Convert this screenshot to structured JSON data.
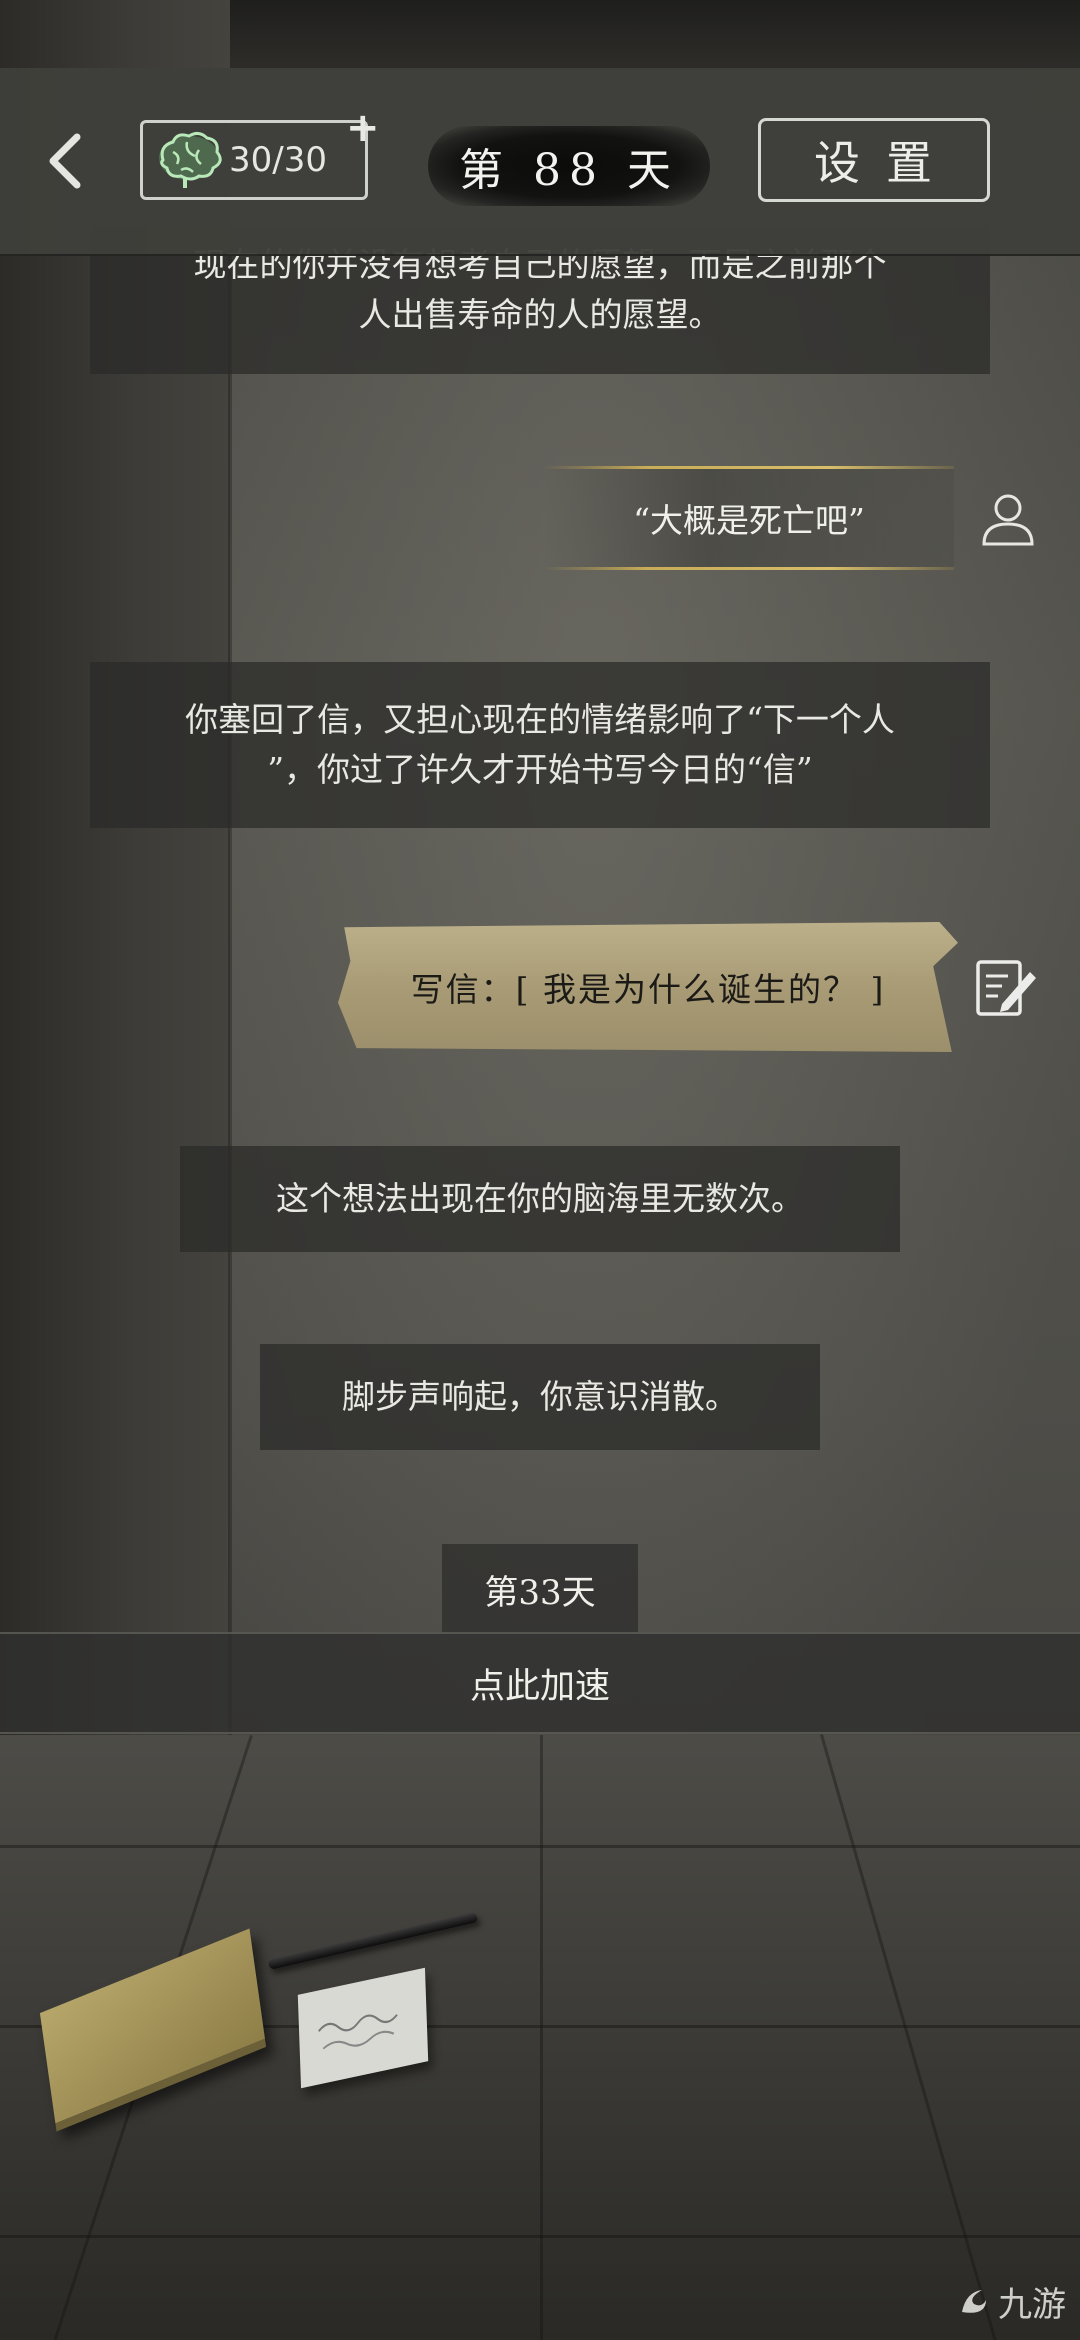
{
  "header": {
    "brain_value": "30/30",
    "plus_label": "+",
    "day_label": "第 88 天",
    "settings_label": "设置"
  },
  "story": {
    "narration_1_line1": "现在的你并没有想考自己的愿望，而是之前那个",
    "narration_1_line2": "人出售寿命的人的愿望。",
    "choice_text": "“大概是死亡吧”",
    "narration_2_line1": "你塞回了信，又担心现在的情绪影响了“下一个人",
    "narration_2_line2": "”，你过了许久才开始书写今日的“信”",
    "letter_text": "写信：[ 我是为什么诞生的？ ]",
    "narration_3": "这个想法出现在你的脑海里无数次。",
    "narration_4": "脚步声响起，你意识消散。",
    "next_day_label": "第33天",
    "speed_up_label": "点此加速"
  },
  "watermark": {
    "text": "九游"
  },
  "colors": {
    "accent_gold": "#c8ac58",
    "brain_green": "#9ed6a0",
    "panel_dark": "#2a2a28",
    "text_light": "#e9e9e4"
  },
  "icons": [
    "back-chevron-icon",
    "brain-icon",
    "plus-icon",
    "user-icon",
    "write-letter-icon",
    "watermark-logo-icon"
  ]
}
